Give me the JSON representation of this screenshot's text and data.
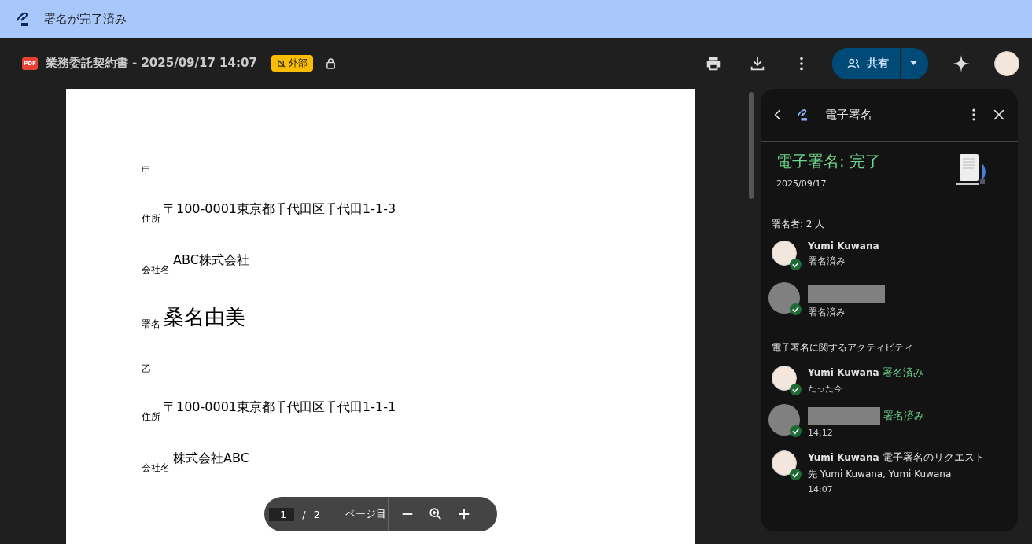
{
  "banner": {
    "title": "署名が完了済み"
  },
  "header": {
    "file_type": "PDF",
    "title": "業務委託契約書 - 2025/09/17 14:07",
    "badge": "外部",
    "share_label": "共有"
  },
  "document": {
    "sections": [
      {
        "heading": "甲",
        "rows": [
          {
            "label": "住所",
            "value": "〒100-0001東京都千代田区千代田1-1-3",
            "kind": "text"
          },
          {
            "label": "会社名",
            "value": "ABC株式会社",
            "kind": "text"
          },
          {
            "label": "署名",
            "value": "桑名由美",
            "kind": "signature"
          }
        ]
      },
      {
        "heading": "乙",
        "rows": [
          {
            "label": "住所",
            "value": "〒100-0001東京都千代田区千代田1-1-1",
            "kind": "text"
          },
          {
            "label": "会社名",
            "value": "株式会社ABC",
            "kind": "text"
          }
        ]
      }
    ]
  },
  "page_toolbar": {
    "page": "1",
    "separator": "/",
    "total": "2",
    "label": "ページ目"
  },
  "panel": {
    "title": "電子署名",
    "status": "電子署名: 完了",
    "date": "2025/09/17",
    "signers_heading": "署名者: 2 人",
    "signers": [
      {
        "name": "Yumi Kuwana",
        "status": "署名済み",
        "redacted": false
      },
      {
        "status": "署名済み",
        "redacted": true
      }
    ],
    "activity_heading": "電子署名に関するアクティビティ",
    "activities": [
      {
        "name": "Yumi Kuwana",
        "action": "署名済み",
        "kind": "signed",
        "time": "たった今",
        "redacted": false
      },
      {
        "action": "署名済み",
        "kind": "signed",
        "time": "14:12",
        "redacted": true
      },
      {
        "name": "Yumi Kuwana",
        "action": "電子署名のリクエスト",
        "kind": "request",
        "detail": "先 Yumi Kuwana, Yumi Kuwana",
        "time": "14:07",
        "redacted": false
      }
    ]
  }
}
